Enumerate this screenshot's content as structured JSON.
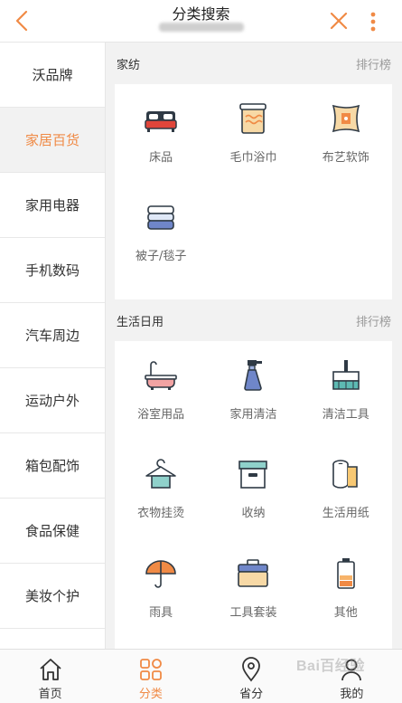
{
  "header": {
    "title": "分类搜索",
    "accent": "#f08a45"
  },
  "sidebar": {
    "items": [
      {
        "label": "沃品牌"
      },
      {
        "label": "家居百货",
        "active": true
      },
      {
        "label": "家用电器"
      },
      {
        "label": "手机数码"
      },
      {
        "label": "汽车周边"
      },
      {
        "label": "运动户外"
      },
      {
        "label": "箱包配饰"
      },
      {
        "label": "食品保健"
      },
      {
        "label": "美妆个护"
      }
    ]
  },
  "sections": [
    {
      "title": "家纺",
      "rank_label": "排行榜",
      "items": [
        {
          "label": "床品",
          "icon": "bed-icon"
        },
        {
          "label": "毛巾浴巾",
          "icon": "towel-icon"
        },
        {
          "label": "布艺软饰",
          "icon": "cushion-icon"
        },
        {
          "label": "被子/毯子",
          "icon": "blanket-icon"
        }
      ]
    },
    {
      "title": "生活日用",
      "rank_label": "排行榜",
      "items": [
        {
          "label": "浴室用品",
          "icon": "bathtub-icon"
        },
        {
          "label": "家用清洁",
          "icon": "spray-bottle-icon"
        },
        {
          "label": "清洁工具",
          "icon": "broom-icon"
        },
        {
          "label": "衣物挂烫",
          "icon": "hanger-icon"
        },
        {
          "label": "收纳",
          "icon": "storage-box-icon"
        },
        {
          "label": "生活用纸",
          "icon": "tissue-roll-icon"
        },
        {
          "label": "雨具",
          "icon": "umbrella-icon"
        },
        {
          "label": "工具套装",
          "icon": "toolbox-icon"
        },
        {
          "label": "其他",
          "icon": "battery-icon"
        }
      ]
    }
  ],
  "tabbar": {
    "items": [
      {
        "label": "首页",
        "icon": "home-icon"
      },
      {
        "label": "分类",
        "icon": "category-icon",
        "active": true
      },
      {
        "label": "省分",
        "icon": "location-pin-icon"
      },
      {
        "label": "我的",
        "icon": "user-icon"
      }
    ]
  },
  "watermark": "Bai百经验"
}
